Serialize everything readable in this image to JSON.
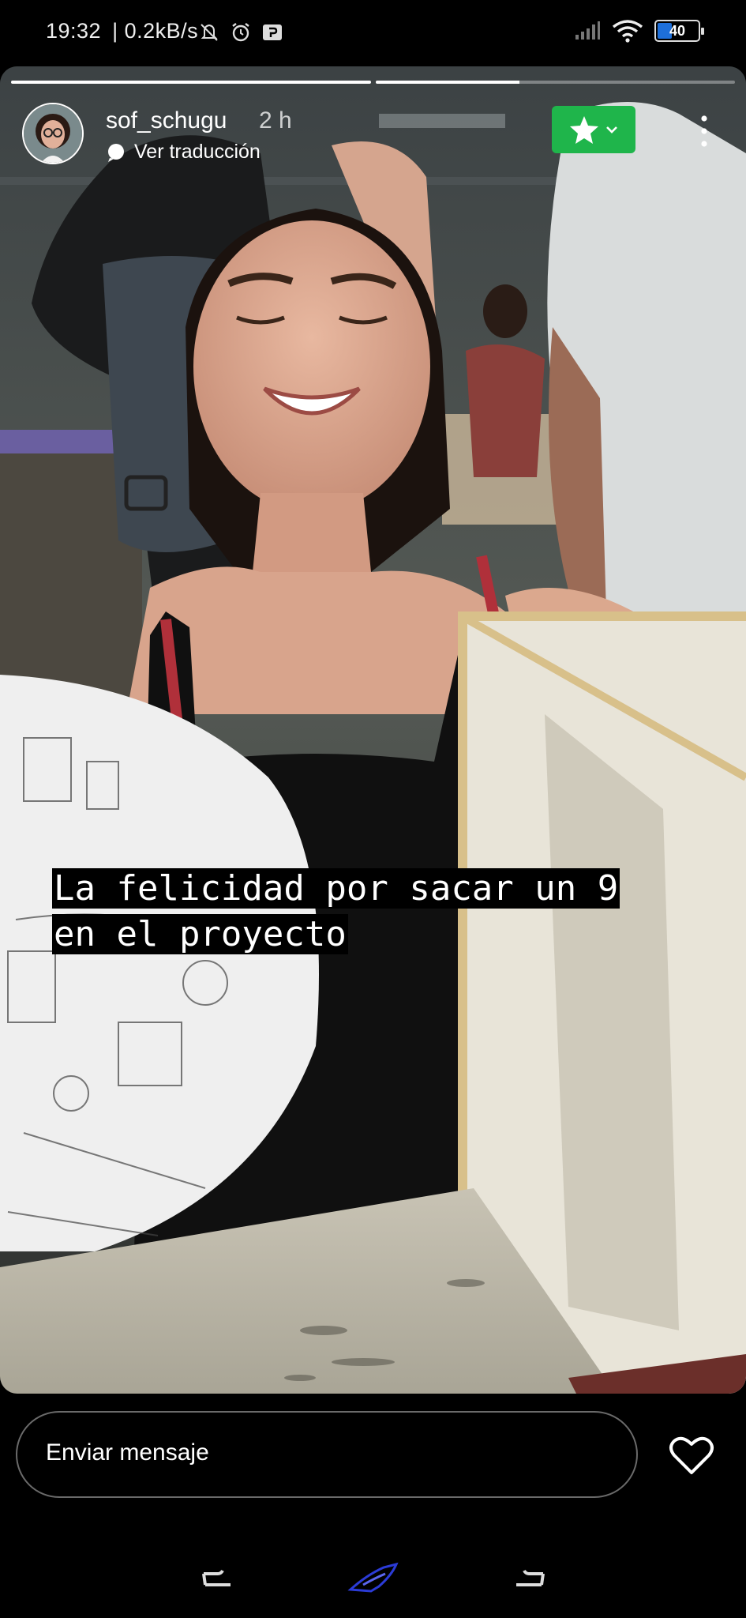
{
  "status_bar": {
    "time": "19:32",
    "network_speed": "| 0.2kB/s",
    "battery_level": "40",
    "battery_percent": 40,
    "icons": [
      "mute-icon",
      "alarm-icon",
      "screencast-icon",
      "signal-icon",
      "wifi-icon",
      "battery-icon"
    ]
  },
  "story": {
    "progress": [
      1.0,
      0.4
    ],
    "username": "sof_schugu",
    "post_time": "2 h",
    "translate_label": "Ver traducción",
    "close_friends_color": "#1fb54b",
    "caption_lines": [
      "La felicidad por sacar un 9",
      "en el proyecto"
    ]
  },
  "reply": {
    "placeholder": "Enviar mensaje"
  },
  "nav": {
    "icons": [
      "back-gesture-icon",
      "home-logo-icon",
      "recents-gesture-icon"
    ],
    "accent": "#2b3bd6"
  }
}
